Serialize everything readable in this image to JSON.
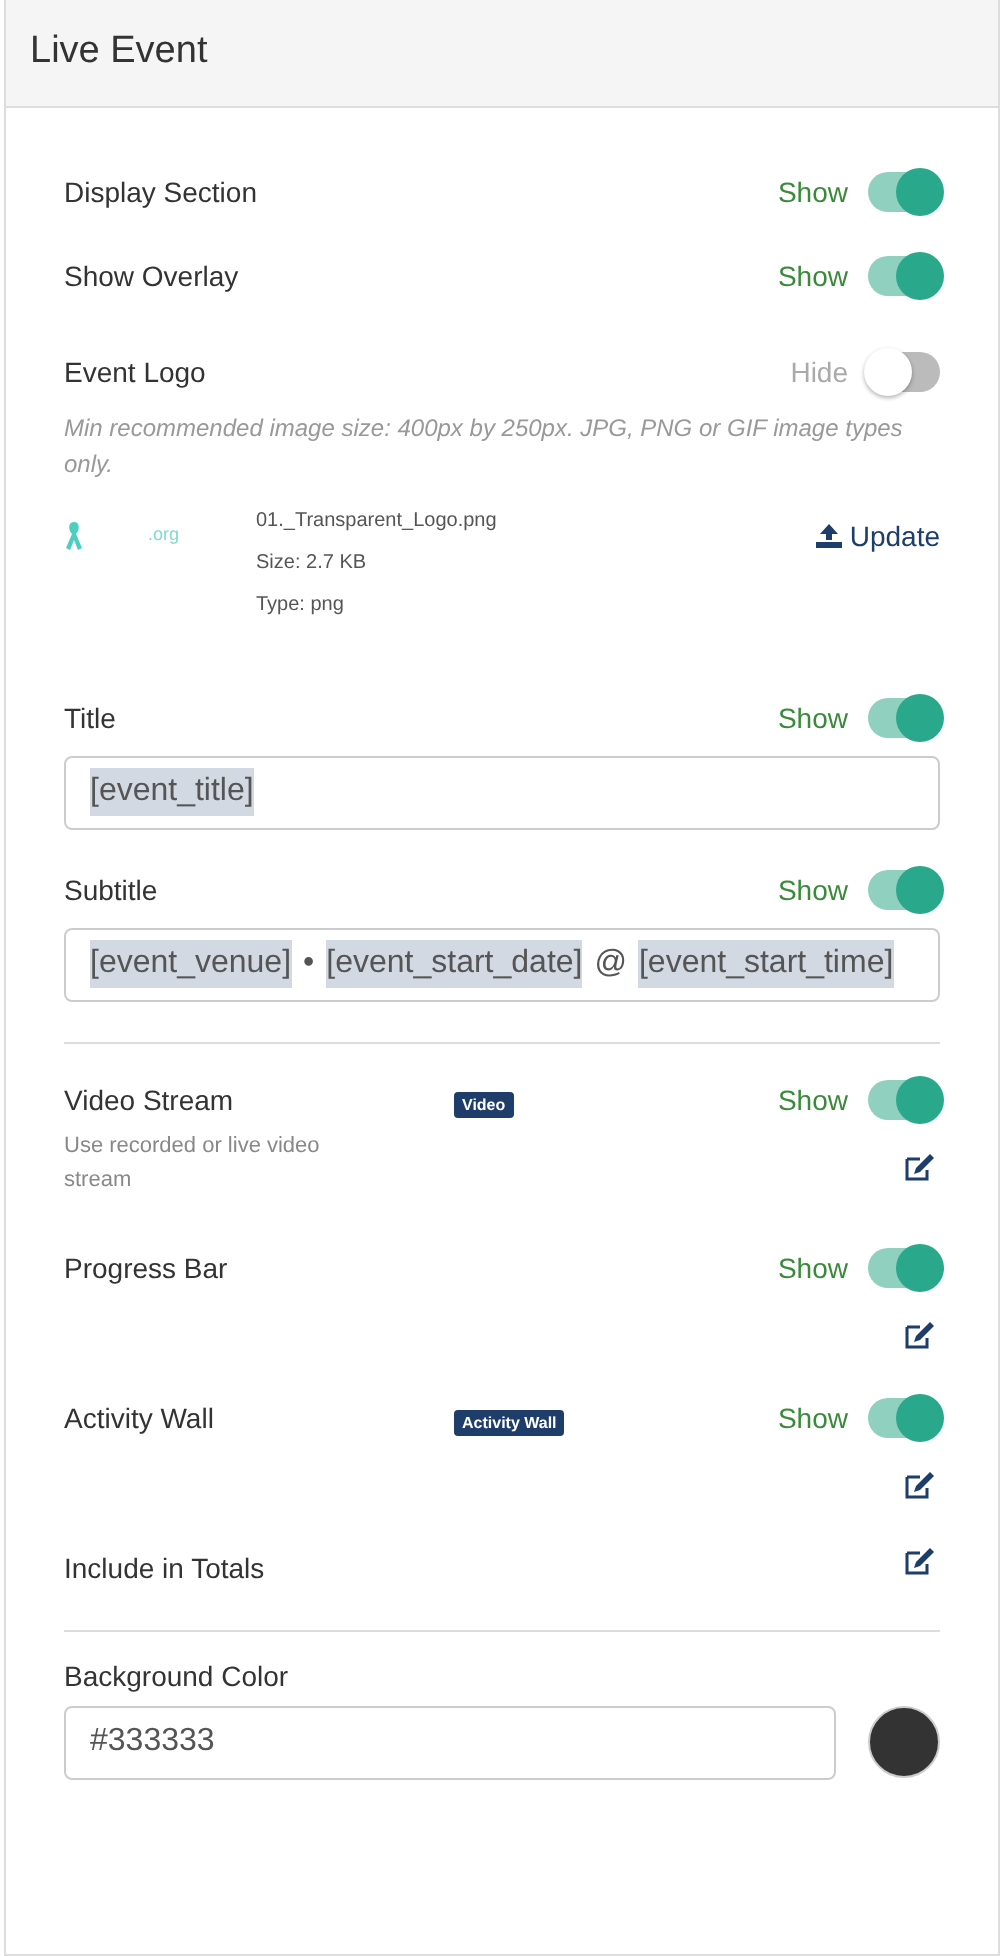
{
  "header": {
    "title": "Live Event"
  },
  "toggles_top": [
    {
      "label": "Display Section",
      "state_label": "Show",
      "on": true
    },
    {
      "label": "Show Overlay",
      "state_label": "Show",
      "on": true
    }
  ],
  "event_logo": {
    "label": "Event Logo",
    "state_label": "Hide",
    "on": false,
    "hint": "Min recommended image size: 400px by 250px. JPG, PNG or GIF image types only.",
    "logo_text": ".org",
    "file_name": "01._Transparent_Logo.png",
    "size": "Size: 2.7 KB",
    "type": "Type: png",
    "update_label": "Update"
  },
  "title": {
    "label": "Title",
    "state_label": "Show",
    "on": true,
    "value": [
      {
        "text": "[event_title]",
        "kind": "tag"
      }
    ]
  },
  "subtitle": {
    "label": "Subtitle",
    "state_label": "Show",
    "on": true,
    "value": [
      {
        "text": "[event_venue]",
        "kind": "tag"
      },
      {
        "text": "•",
        "kind": "plain"
      },
      {
        "text": "[event_start_date]",
        "kind": "tag"
      },
      {
        "text": "@",
        "kind": "plain"
      },
      {
        "text": "[event_start_time]",
        "kind": "tag"
      }
    ]
  },
  "features": [
    {
      "label": "Video Stream",
      "badge": "Video",
      "description": "Use recorded or live video stream",
      "state_label": "Show",
      "on": true,
      "kind": "toggle"
    },
    {
      "label": "Progress Bar",
      "state_label": "Show",
      "on": true,
      "kind": "toggle"
    },
    {
      "label": "Activity Wall",
      "badge": "Activity Wall",
      "state_label": "Show",
      "on": true,
      "kind": "toggle"
    },
    {
      "label": "Include in Totals",
      "kind": "edit"
    }
  ],
  "background_color": {
    "label": "Background Color",
    "value": "#333333",
    "color": "#333333"
  }
}
